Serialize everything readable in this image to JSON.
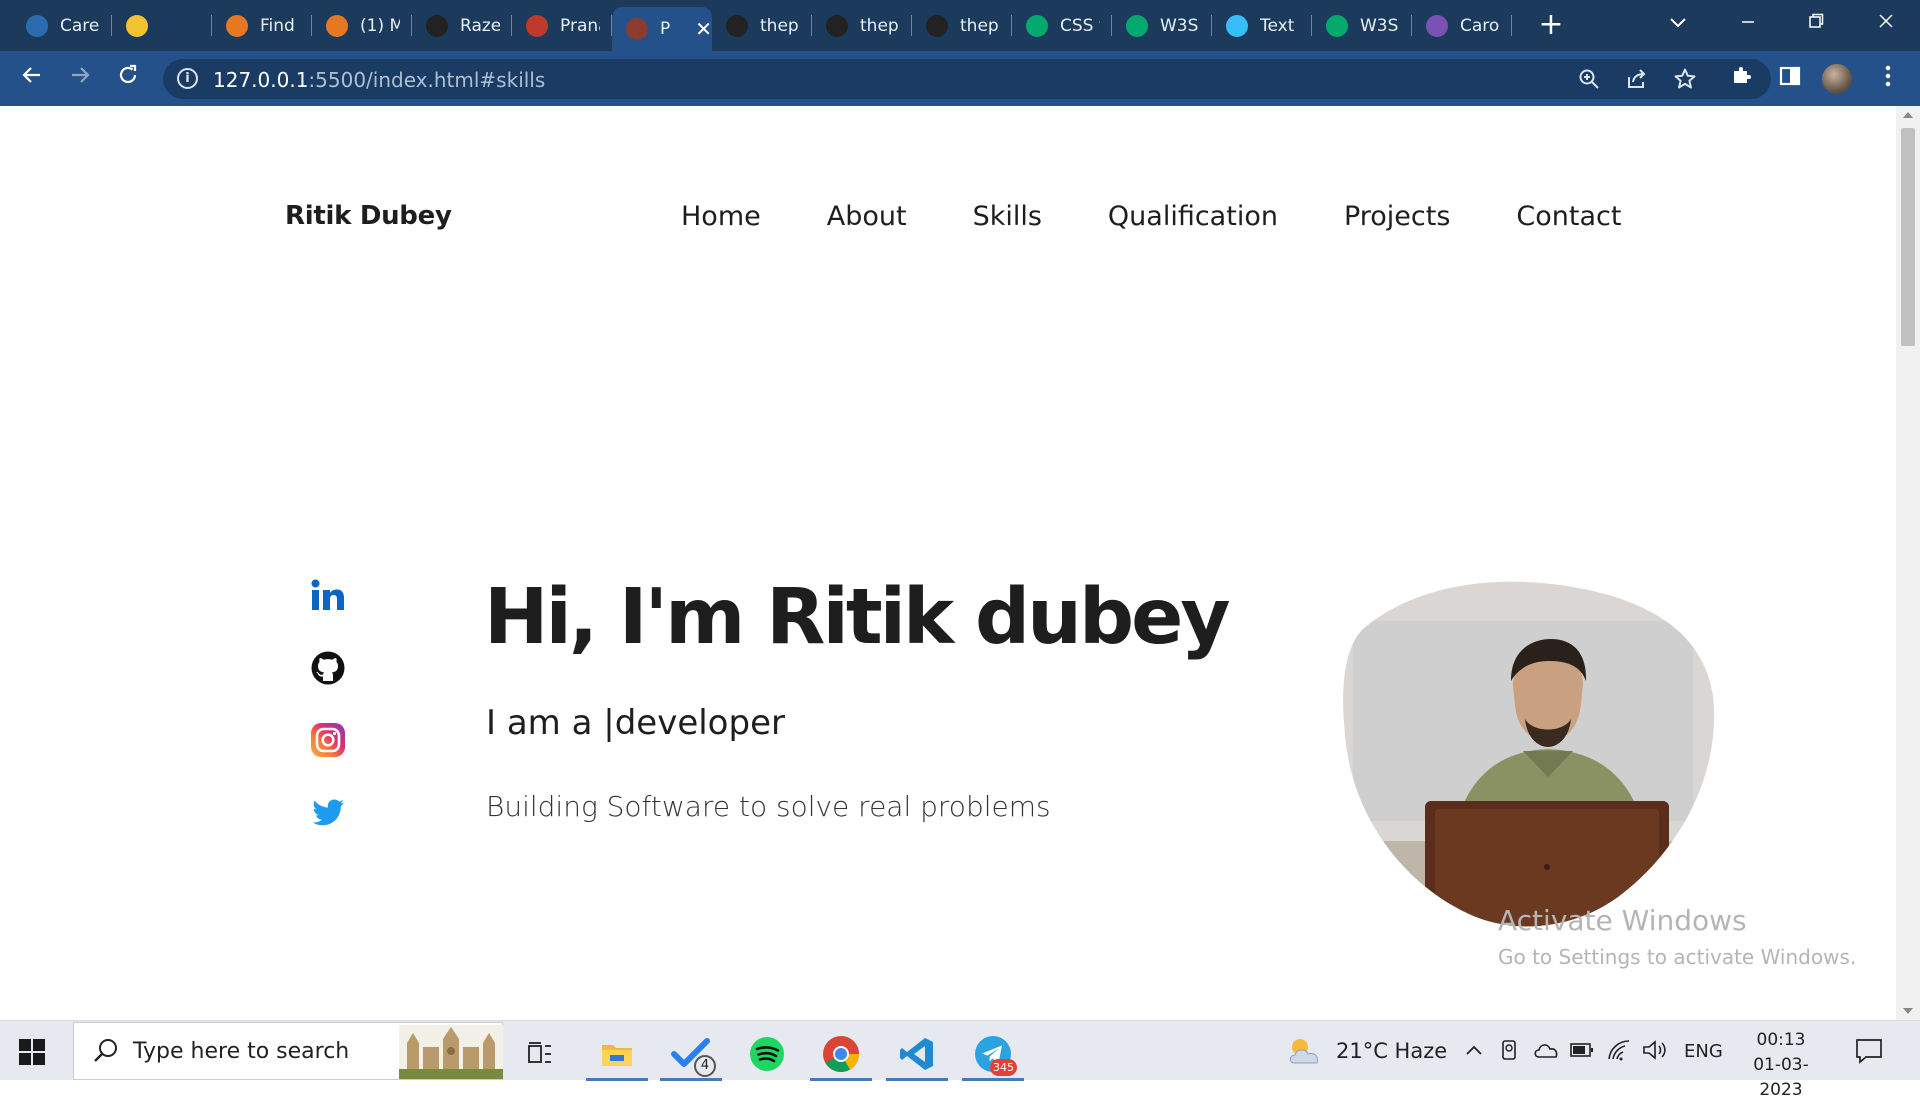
{
  "browser": {
    "tabs": [
      {
        "label": "Caree",
        "icon": "headset-icon",
        "color": "#2b6cb0"
      },
      {
        "label": "",
        "icon": "emoji-icon",
        "color": "#f3c430"
      },
      {
        "label": "Find",
        "icon": "stack-icon",
        "color": "#e87722"
      },
      {
        "label": "(1) M",
        "icon": "stack-icon",
        "color": "#e87722"
      },
      {
        "label": "Raze",
        "icon": "github-icon",
        "color": "#222"
      },
      {
        "label": "Prana",
        "icon": "avatar-icon",
        "color": "#c0392b"
      },
      {
        "label": "P",
        "icon": "avatar-icon",
        "color": "#8e3b2f",
        "active": true
      },
      {
        "label": "thep",
        "icon": "github-icon",
        "color": "#222"
      },
      {
        "label": "thep",
        "icon": "github-icon",
        "color": "#222"
      },
      {
        "label": "thep",
        "icon": "github-icon",
        "color": "#222"
      },
      {
        "label": "CSS v",
        "icon": "w3-icon",
        "color": "#04aa6d"
      },
      {
        "label": "W3S",
        "icon": "w3-icon",
        "color": "#04aa6d"
      },
      {
        "label": "Text",
        "icon": "tailwind-icon",
        "color": "#38bdf8"
      },
      {
        "label": "W3S",
        "icon": "w3-icon",
        "color": "#04aa6d"
      },
      {
        "label": "Caro",
        "icon": "bootstrap-icon",
        "color": "#7952b3"
      }
    ],
    "url_host": "127.0.0.1",
    "url_rest": ":5500/index.html#skills"
  },
  "page": {
    "brand": "Ritik Dubey",
    "nav": [
      "Home",
      "About",
      "Skills",
      "Qualification",
      "Projects",
      "Contact"
    ],
    "hero_title": "Hi, I'm Ritik dubey",
    "hero_sub": "I am a |developer",
    "hero_desc": "Building Software to solve real problems",
    "socials": [
      "linkedin-icon",
      "github-icon",
      "instagram-icon",
      "twitter-icon"
    ]
  },
  "watermark": {
    "line1": "Activate Windows",
    "line2": "Go to Settings to activate Windows."
  },
  "taskbar": {
    "search_placeholder": "Type here to search",
    "todo_badge": "4",
    "telegram_badge": "345",
    "weather": "21°C  Haze",
    "language": "ENG",
    "time": "00:13",
    "date": "01-03-2023"
  }
}
